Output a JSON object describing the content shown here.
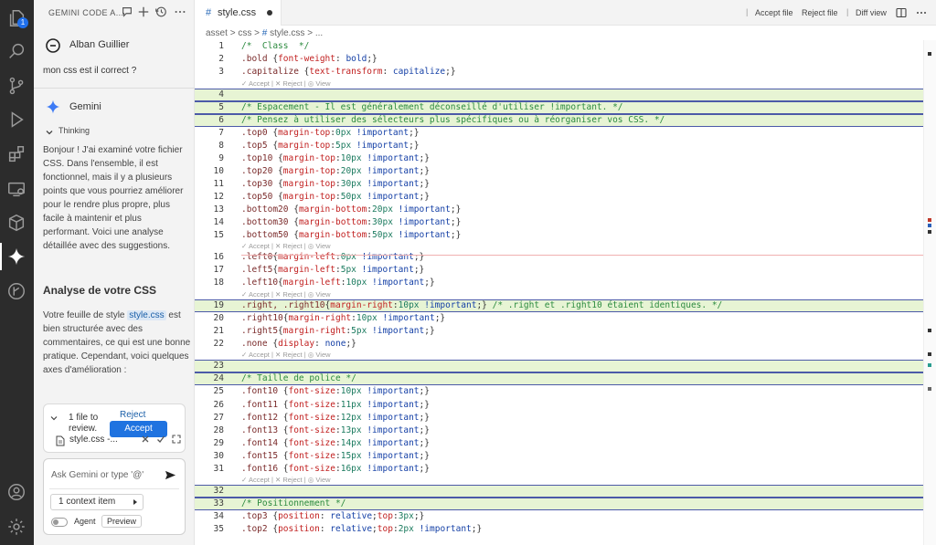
{
  "activity_bar": {
    "badge": "1",
    "icons": [
      "files-icon",
      "search-icon",
      "source-control-icon",
      "run-debug-icon",
      "extensions-icon",
      "remote-explorer-icon",
      "package-icon",
      "gemini-icon",
      "timeline-icon",
      "account-icon",
      "settings-gear-icon"
    ]
  },
  "chat": {
    "title": "GEMINI CODE A...",
    "user_name": "Alban Guillier",
    "user_message": "mon css est il correct ?",
    "assistant_name": "Gemini",
    "thinking_label": "Thinking",
    "intro": "Bonjour ! J'ai examiné votre fichier CSS. Dans l'ensemble, il est fonctionnel, mais il y a plusieurs points que vous pourriez améliorer pour le rendre plus propre, plus facile à maintenir et plus performant. Voici une analyse détaillée avec des suggestions.",
    "analysis_title": "Analyse de votre CSS",
    "body_before": "Votre feuille de style ",
    "body_chip": "style.css",
    "body_after": " est bien structurée avec des commentaires, ce qui est une bonne pratique. Cependant, voici quelques axes d'amélioration :",
    "review": {
      "summary": "1 file to review.",
      "file": "style.css -...",
      "reject": "Reject",
      "accept": "Accept"
    },
    "input": {
      "placeholder": "Ask Gemini or type '@'",
      "context_item": "1 context item",
      "agent_label": "Agent",
      "preview_label": "Preview"
    }
  },
  "editor": {
    "tab_hash": "#",
    "tab_name": "style.css",
    "actions": {
      "accept_file": "Accept file",
      "reject_file": "Reject file",
      "diff_view": "Diff view"
    },
    "breadcrumb": [
      "asset",
      ">",
      "css",
      ">",
      "#",
      "style.css",
      ">",
      "..."
    ],
    "accept_bar": {
      "accept": "Accept",
      "sep": "|",
      "reject": "Reject",
      "view": "View"
    },
    "lines": [
      {
        "n": "1",
        "kind": "code",
        "tokens": [
          [
            "c-com",
            "/*  Class  */"
          ]
        ]
      },
      {
        "n": "2",
        "kind": "code",
        "tokens": [
          [
            "c-sel",
            ".bold "
          ],
          [
            "",
            "{"
          ],
          [
            "c-prop",
            "font-weight"
          ],
          [
            "",
            ": "
          ],
          [
            "c-kw",
            "bold"
          ],
          [
            "",
            ";}"
          ]
        ]
      },
      {
        "n": "3",
        "kind": "code",
        "tokens": [
          [
            "c-sel",
            ".capitalize "
          ],
          [
            "",
            "{"
          ],
          [
            "c-prop",
            "text-transform"
          ],
          [
            "",
            ": "
          ],
          [
            "c-kw",
            "capitalize"
          ],
          [
            "",
            ";}"
          ]
        ]
      },
      {
        "kind": "accept"
      },
      {
        "n": "4",
        "kind": "hl",
        "tokens": []
      },
      {
        "n": "5",
        "kind": "hl",
        "tokens": [
          [
            "c-com",
            "/* Espacement - Il est généralement déconseillé d'utiliser !important. */"
          ]
        ]
      },
      {
        "n": "6",
        "kind": "hl",
        "tokens": [
          [
            "c-com",
            "/* Pensez à utiliser des sélecteurs plus spécifiques ou à réorganiser vos CSS. */"
          ]
        ]
      },
      {
        "n": "7",
        "kind": "code",
        "tokens": [
          [
            "c-sel",
            ".top0 "
          ],
          [
            "",
            "{"
          ],
          [
            "c-prop",
            "margin-top"
          ],
          [
            "",
            ":"
          ],
          [
            "c-num",
            "0px"
          ],
          [
            "c-kw",
            " !important"
          ],
          [
            "",
            ";}"
          ]
        ]
      },
      {
        "n": "8",
        "kind": "code",
        "tokens": [
          [
            "c-sel",
            ".top5 "
          ],
          [
            "",
            "{"
          ],
          [
            "c-prop",
            "margin-top"
          ],
          [
            "",
            ":"
          ],
          [
            "c-num",
            "5px"
          ],
          [
            "c-kw",
            " !important"
          ],
          [
            "",
            ";}"
          ]
        ]
      },
      {
        "n": "9",
        "kind": "code",
        "tokens": [
          [
            "c-sel",
            ".top10 "
          ],
          [
            "",
            "{"
          ],
          [
            "c-prop",
            "margin-top"
          ],
          [
            "",
            ":"
          ],
          [
            "c-num",
            "10px"
          ],
          [
            "c-kw",
            " !important"
          ],
          [
            "",
            ";}"
          ]
        ]
      },
      {
        "n": "10",
        "kind": "code",
        "tokens": [
          [
            "c-sel",
            ".top20 "
          ],
          [
            "",
            "{"
          ],
          [
            "c-prop",
            "margin-top"
          ],
          [
            "",
            ":"
          ],
          [
            "c-num",
            "20px"
          ],
          [
            "c-kw",
            " !important"
          ],
          [
            "",
            ";}"
          ]
        ]
      },
      {
        "n": "11",
        "kind": "code",
        "tokens": [
          [
            "c-sel",
            ".top30 "
          ],
          [
            "",
            "{"
          ],
          [
            "c-prop",
            "margin-top"
          ],
          [
            "",
            ":"
          ],
          [
            "c-num",
            "30px"
          ],
          [
            "c-kw",
            " !important"
          ],
          [
            "",
            ";}"
          ]
        ]
      },
      {
        "n": "12",
        "kind": "code",
        "tokens": [
          [
            "c-sel",
            ".top50 "
          ],
          [
            "",
            "{"
          ],
          [
            "c-prop",
            "margin-top"
          ],
          [
            "",
            ":"
          ],
          [
            "c-num",
            "50px"
          ],
          [
            "c-kw",
            " !important"
          ],
          [
            "",
            ";}"
          ]
        ]
      },
      {
        "n": "13",
        "kind": "code",
        "tokens": [
          [
            "c-sel",
            ".bottom20 "
          ],
          [
            "",
            "{"
          ],
          [
            "c-prop",
            "margin-bottom"
          ],
          [
            "",
            ":"
          ],
          [
            "c-num",
            "20px"
          ],
          [
            "c-kw",
            " !important"
          ],
          [
            "",
            ";}"
          ]
        ]
      },
      {
        "n": "14",
        "kind": "code",
        "tokens": [
          [
            "c-sel",
            ".bottom30 "
          ],
          [
            "",
            "{"
          ],
          [
            "c-prop",
            "margin-bottom"
          ],
          [
            "",
            ":"
          ],
          [
            "c-num",
            "30px"
          ],
          [
            "c-kw",
            " !important"
          ],
          [
            "",
            ";}"
          ]
        ]
      },
      {
        "n": "15",
        "kind": "code",
        "tokens": [
          [
            "c-sel",
            ".bottom50 "
          ],
          [
            "",
            "{"
          ],
          [
            "c-prop",
            "margin-bottom"
          ],
          [
            "",
            ":"
          ],
          [
            "c-num",
            "50px"
          ],
          [
            "c-kw",
            " !important"
          ],
          [
            "",
            ";}"
          ]
        ]
      },
      {
        "kind": "accept"
      },
      {
        "n": "16",
        "kind": "code",
        "tokens": [
          [
            "c-sel",
            ".left0"
          ],
          [
            "",
            "{"
          ],
          [
            "c-prop",
            "margin-left"
          ],
          [
            "",
            ":"
          ],
          [
            "c-num",
            "0px"
          ],
          [
            "c-kw",
            " !important"
          ],
          [
            "",
            ";}"
          ]
        ]
      },
      {
        "n": "17",
        "kind": "code",
        "tokens": [
          [
            "c-sel",
            ".left5"
          ],
          [
            "",
            "{"
          ],
          [
            "c-prop",
            "margin-left"
          ],
          [
            "",
            ":"
          ],
          [
            "c-num",
            "5px"
          ],
          [
            "c-kw",
            " !important"
          ],
          [
            "",
            ";}"
          ]
        ]
      },
      {
        "n": "18",
        "kind": "code",
        "tokens": [
          [
            "c-sel",
            ".left10"
          ],
          [
            "",
            "{"
          ],
          [
            "c-prop",
            "margin-left"
          ],
          [
            "",
            ":"
          ],
          [
            "c-num",
            "10px"
          ],
          [
            "c-kw",
            " !important"
          ],
          [
            "",
            ";}"
          ]
        ]
      },
      {
        "kind": "accept"
      },
      {
        "n": "19",
        "kind": "hl",
        "tokens": [
          [
            "c-sel",
            ".right, .right10"
          ],
          [
            "",
            "{"
          ],
          [
            "c-prop",
            "margin-right"
          ],
          [
            "",
            ":"
          ],
          [
            "c-num",
            "10px"
          ],
          [
            "c-kw",
            " !important"
          ],
          [
            "",
            ";} "
          ],
          [
            "c-com",
            "/* .right et .right10 étaient identiques. */"
          ]
        ]
      },
      {
        "n": "20",
        "kind": "code",
        "tokens": [
          [
            "c-sel",
            ".right10"
          ],
          [
            "",
            "{"
          ],
          [
            "c-prop",
            "margin-right"
          ],
          [
            "",
            ":"
          ],
          [
            "c-num",
            "10px"
          ],
          [
            "c-kw",
            " !important"
          ],
          [
            "",
            ";}"
          ]
        ]
      },
      {
        "n": "21",
        "kind": "code",
        "tokens": [
          [
            "c-sel",
            ".right5"
          ],
          [
            "",
            "{"
          ],
          [
            "c-prop",
            "margin-right"
          ],
          [
            "",
            ":"
          ],
          [
            "c-num",
            "5px"
          ],
          [
            "c-kw",
            " !important"
          ],
          [
            "",
            ";}"
          ]
        ]
      },
      {
        "n": "22",
        "kind": "code",
        "tokens": [
          [
            "c-sel",
            ".none "
          ],
          [
            "",
            "{"
          ],
          [
            "c-prop",
            "display"
          ],
          [
            "",
            ": "
          ],
          [
            "c-kw",
            "none"
          ],
          [
            "",
            ";}"
          ]
        ]
      },
      {
        "kind": "accept"
      },
      {
        "n": "23",
        "kind": "hl",
        "tokens": []
      },
      {
        "n": "24",
        "kind": "hl",
        "tokens": [
          [
            "c-com",
            "/* Taille de police */"
          ]
        ]
      },
      {
        "n": "25",
        "kind": "code",
        "tokens": [
          [
            "c-sel",
            ".font10 "
          ],
          [
            "",
            "{"
          ],
          [
            "c-prop",
            "font-size"
          ],
          [
            "",
            ":"
          ],
          [
            "c-num",
            "10px"
          ],
          [
            "c-kw",
            " !important"
          ],
          [
            "",
            ";}"
          ]
        ]
      },
      {
        "n": "26",
        "kind": "code",
        "tokens": [
          [
            "c-sel",
            ".font11 "
          ],
          [
            "",
            "{"
          ],
          [
            "c-prop",
            "font-size"
          ],
          [
            "",
            ":"
          ],
          [
            "c-num",
            "11px"
          ],
          [
            "c-kw",
            " !important"
          ],
          [
            "",
            ";}"
          ]
        ]
      },
      {
        "n": "27",
        "kind": "code",
        "tokens": [
          [
            "c-sel",
            ".font12 "
          ],
          [
            "",
            "{"
          ],
          [
            "c-prop",
            "font-size"
          ],
          [
            "",
            ":"
          ],
          [
            "c-num",
            "12px"
          ],
          [
            "c-kw",
            " !important"
          ],
          [
            "",
            ";}"
          ]
        ]
      },
      {
        "n": "28",
        "kind": "code",
        "tokens": [
          [
            "c-sel",
            ".font13 "
          ],
          [
            "",
            "{"
          ],
          [
            "c-prop",
            "font-size"
          ],
          [
            "",
            ":"
          ],
          [
            "c-num",
            "13px"
          ],
          [
            "c-kw",
            " !important"
          ],
          [
            "",
            ";}"
          ]
        ]
      },
      {
        "n": "29",
        "kind": "code",
        "tokens": [
          [
            "c-sel",
            ".font14 "
          ],
          [
            "",
            "{"
          ],
          [
            "c-prop",
            "font-size"
          ],
          [
            "",
            ":"
          ],
          [
            "c-num",
            "14px"
          ],
          [
            "c-kw",
            " !important"
          ],
          [
            "",
            ";}"
          ]
        ]
      },
      {
        "n": "30",
        "kind": "code",
        "tokens": [
          [
            "c-sel",
            ".font15 "
          ],
          [
            "",
            "{"
          ],
          [
            "c-prop",
            "font-size"
          ],
          [
            "",
            ":"
          ],
          [
            "c-num",
            "15px"
          ],
          [
            "c-kw",
            " !important"
          ],
          [
            "",
            ";}"
          ]
        ]
      },
      {
        "n": "31",
        "kind": "code",
        "tokens": [
          [
            "c-sel",
            ".font16 "
          ],
          [
            "",
            "{"
          ],
          [
            "c-prop",
            "font-size"
          ],
          [
            "",
            ":"
          ],
          [
            "c-num",
            "16px"
          ],
          [
            "c-kw",
            " !important"
          ],
          [
            "",
            ";}"
          ]
        ]
      },
      {
        "kind": "accept"
      },
      {
        "n": "32",
        "kind": "hl",
        "tokens": []
      },
      {
        "n": "33",
        "kind": "hl",
        "tokens": [
          [
            "c-com",
            "/* Positionnement */"
          ]
        ]
      },
      {
        "n": "34",
        "kind": "code",
        "tokens": [
          [
            "c-sel",
            ".top3 "
          ],
          [
            "",
            "{"
          ],
          [
            "c-prop",
            "position"
          ],
          [
            "",
            ": "
          ],
          [
            "c-kw",
            "relative"
          ],
          [
            "",
            ";"
          ],
          [
            "c-prop",
            "top"
          ],
          [
            "",
            ":"
          ],
          [
            "c-num",
            "3px"
          ],
          [
            "",
            ";}"
          ]
        ]
      },
      {
        "n": "35",
        "kind": "code",
        "tokens": [
          [
            "c-sel",
            ".top2 "
          ],
          [
            "",
            "{"
          ],
          [
            "c-prop",
            "position"
          ],
          [
            "",
            ": "
          ],
          [
            "c-kw",
            "relative"
          ],
          [
            "",
            ";"
          ],
          [
            "c-prop",
            "top"
          ],
          [
            "",
            ":"
          ],
          [
            "c-num",
            "2px"
          ],
          [
            "c-kw",
            " !important"
          ],
          [
            "",
            ";}"
          ]
        ]
      }
    ]
  },
  "colors": {
    "activity_bg": "#2c2c2c",
    "accent_blue": "#1f73e0",
    "added_line_bg": "#e7f4d4",
    "comment": "#2b8a3e",
    "property": "#c11f1f"
  }
}
